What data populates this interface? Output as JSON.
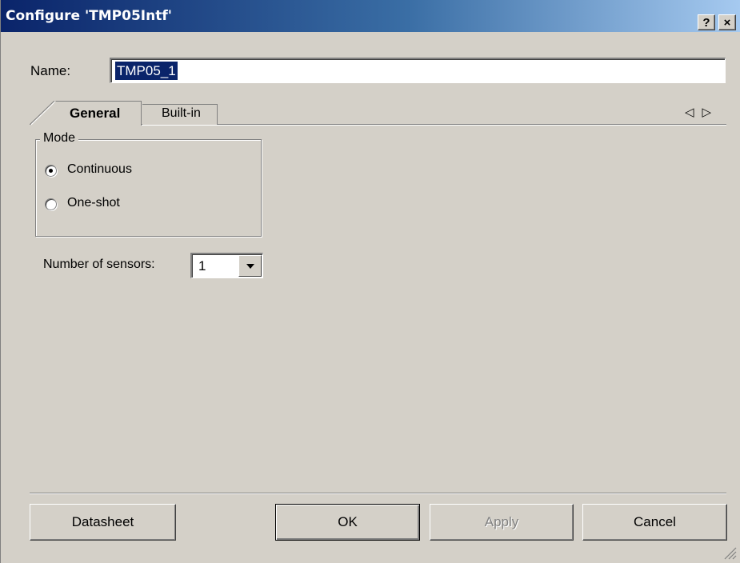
{
  "window": {
    "title": "Configure 'TMP05Intf'",
    "help_label": "?",
    "close_label": "×"
  },
  "name": {
    "label": "Name:",
    "value": "TMP05_1"
  },
  "tabs": [
    {
      "label": "General",
      "active": true
    },
    {
      "label": "Built-in",
      "active": false
    }
  ],
  "tab_scroll": {
    "left": "◁",
    "right": "▷"
  },
  "mode": {
    "legend": "Mode",
    "options": [
      {
        "label": "Continuous",
        "selected": true
      },
      {
        "label": "One-shot",
        "selected": false
      }
    ]
  },
  "sensors": {
    "label": "Number of sensors:",
    "value": "1"
  },
  "buttons": {
    "datasheet": "Datasheet",
    "ok": "OK",
    "apply": "Apply",
    "cancel": "Cancel"
  },
  "colors": {
    "title_start": "#0a246a",
    "title_end": "#a6caf0",
    "face": "#d4d0c8"
  }
}
